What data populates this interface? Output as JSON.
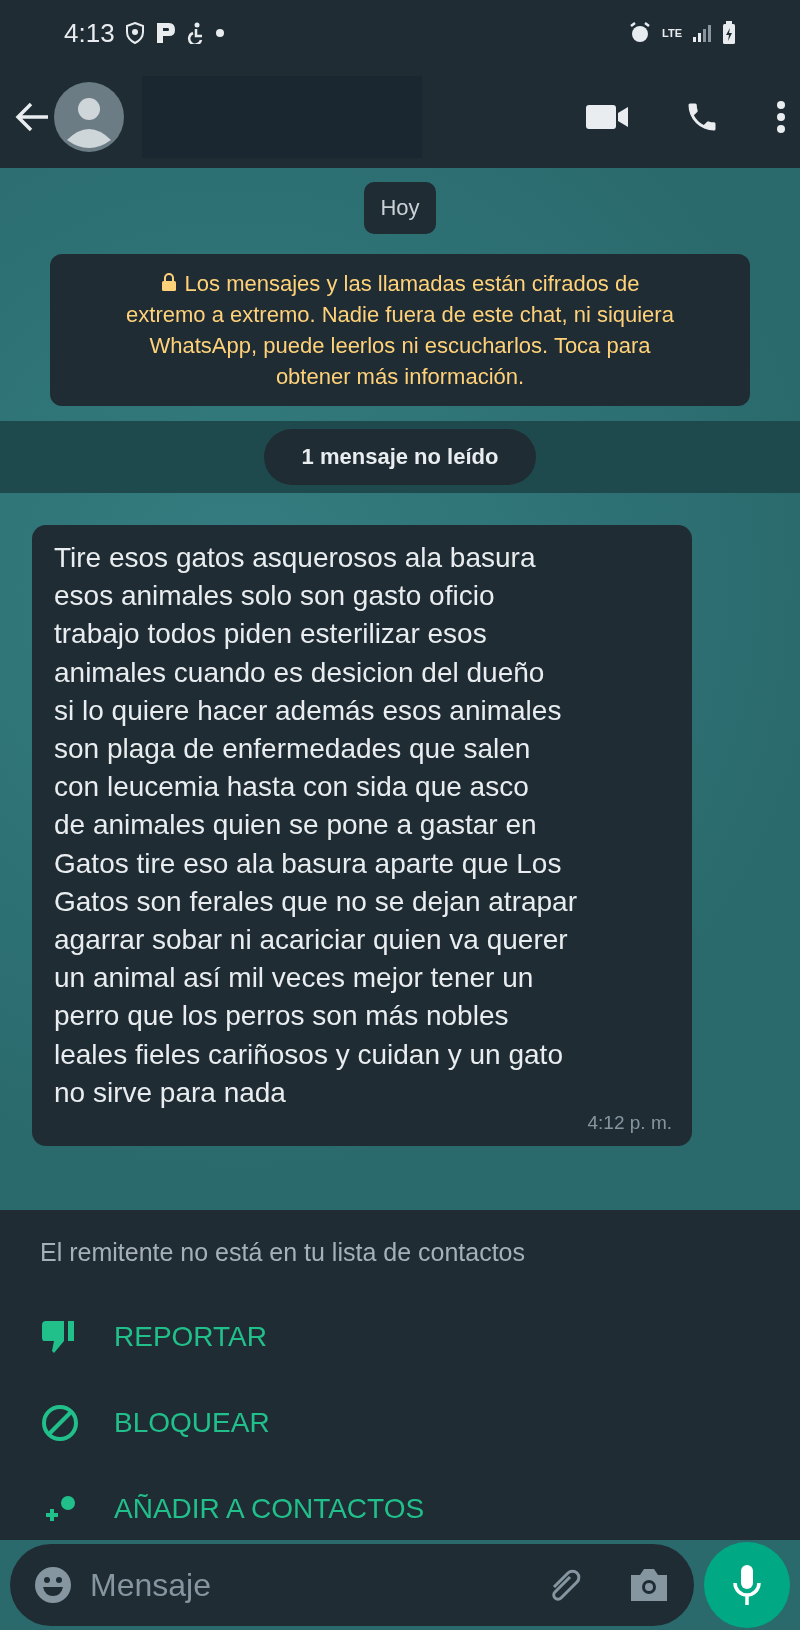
{
  "status_bar": {
    "time": "4:13",
    "network": "LTE"
  },
  "chat": {
    "date_chip": "Hoy",
    "encryption_notice": "Los mensajes y las llamadas están cifrados de\nextremo a extremo. Nadie fuera de este chat, ni siquiera\nWhatsApp, puede leerlos ni escucharlos. Toca para\nobtener más información.",
    "unread_banner": "1 mensaje no leído",
    "messages": [
      {
        "text": "Tire esos gatos asquerosos ala basura\nesos animales solo son gasto oficio\ntrabajo todos piden esterilizar esos\nanimales cuando es desicion del dueño\nsi lo quiere hacer además esos animales\nson plaga de enfermedades que salen\ncon leucemia hasta con sida que asco\nde animales quien se pone a gastar en\nGatos tire eso ala basura aparte que Los\nGatos son ferales que no se dejan atrapar\nagarrar sobar ni acariciar quien va querer\nun animal así mil veces mejor tener un\nperro que los perros son más nobles\nleales fieles cariñosos y cuidan y un gato\nno sirve para nada",
        "time": "4:12 p. m."
      }
    ]
  },
  "unknown_sender": {
    "notice": "El remitente no está en tu lista de contactos",
    "actions": [
      {
        "kind": "report",
        "label": "REPORTAR"
      },
      {
        "kind": "block",
        "label": "BLOQUEAR"
      },
      {
        "kind": "add",
        "label": "AÑADIR A CONTACTOS"
      }
    ]
  },
  "composer": {
    "placeholder": "Mensaje"
  }
}
